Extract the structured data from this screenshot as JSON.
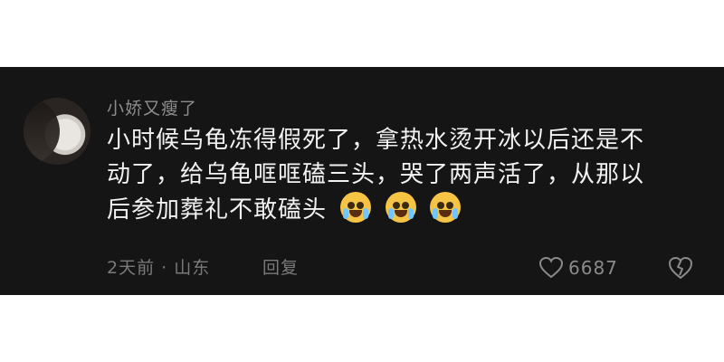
{
  "comment": {
    "username": "小娇又瘦了",
    "text_lines": [
      "小时候乌龟冻得假死了，拿热水烫开冰以后还是不",
      "动了，给乌龟哐哐磕三头，哭了两声活了，从那以",
      "后参加葬礼不敢磕头"
    ],
    "emojis": [
      "crying-laughing-emoji",
      "crying-laughing-emoji",
      "crying-laughing-emoji"
    ],
    "meta": "2天前 · 山东",
    "reply_label": "回复",
    "like_count": "6687"
  },
  "colors": {
    "background": "#151515",
    "username": "#8c8c8c",
    "text": "#f2f2f2",
    "meta": "#7a7a7a"
  }
}
